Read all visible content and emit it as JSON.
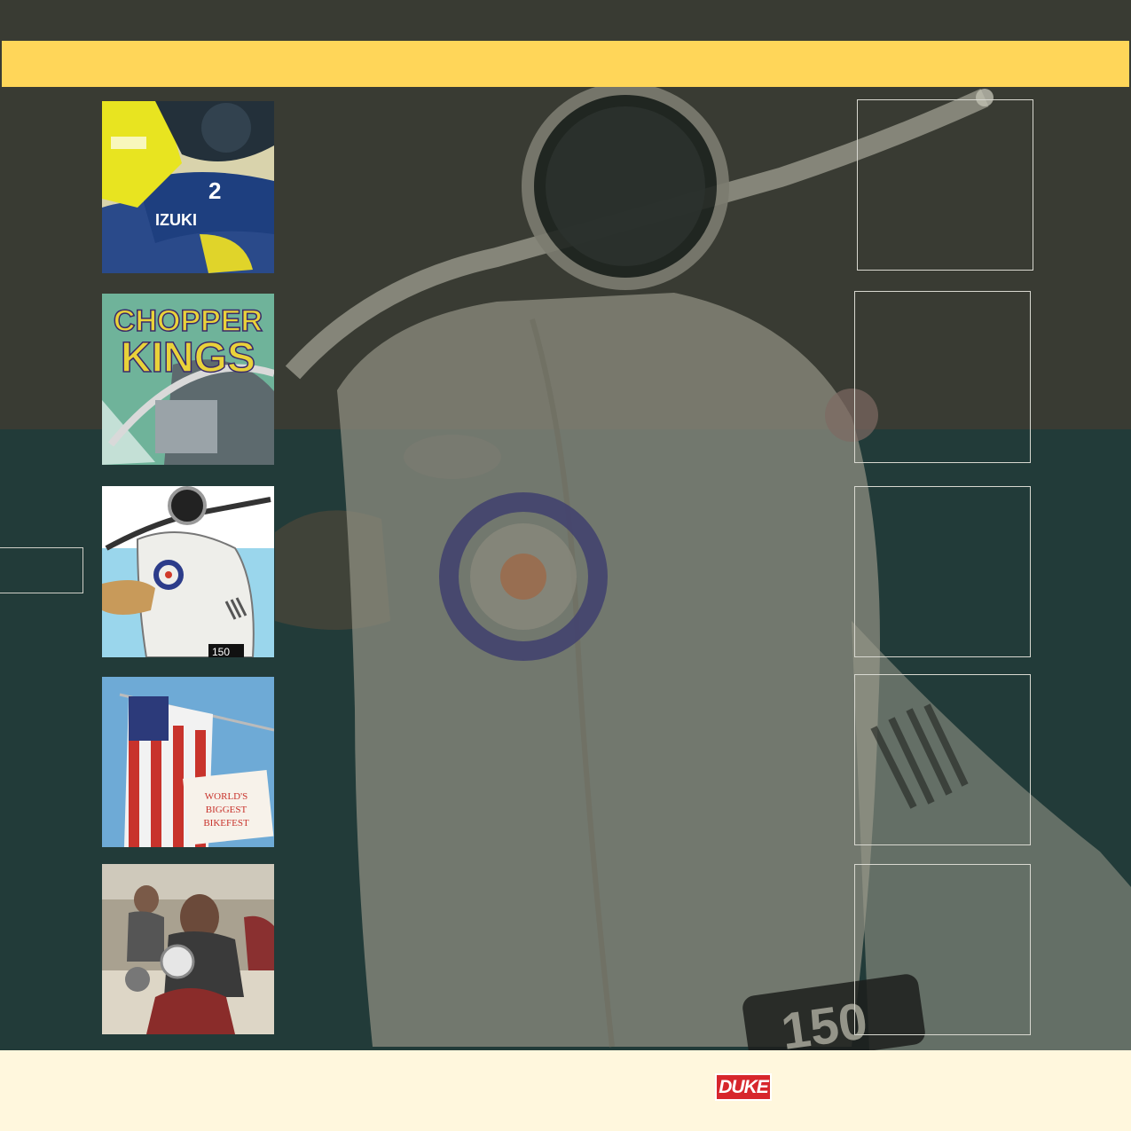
{
  "colors": {
    "top_background": "#393b33",
    "bottom_background": "#223b39",
    "header_band": "#ffd659",
    "footer_background": "#fff7dd",
    "logo_red": "#d7262c",
    "frame_border": "#d8d8d0"
  },
  "thumbnails": [
    {
      "icon": "racing-rider-image",
      "printed_text": [
        "IZUKI",
        "2"
      ]
    },
    {
      "icon": "chopper-kings-image",
      "printed_text": [
        "CHOPPER",
        "KINGS"
      ]
    },
    {
      "icon": "scooter-image",
      "printed_text": [
        "150"
      ]
    },
    {
      "icon": "flag-bikefest-image",
      "printed_text": [
        "WORLD'S",
        "BIGGEST",
        "BIKEFEST"
      ]
    },
    {
      "icon": "bikers-image",
      "printed_text": []
    }
  ],
  "background_image": {
    "icon": "scooter-background-image",
    "printed_text": [
      "150"
    ]
  },
  "frames": [
    {
      "icon": "empty-frame"
    },
    {
      "icon": "empty-frame"
    },
    {
      "icon": "empty-frame"
    },
    {
      "icon": "empty-frame"
    },
    {
      "icon": "empty-frame"
    }
  ],
  "footer": {
    "logo": {
      "text": "DUKE",
      "icon": "duke-logo"
    }
  }
}
